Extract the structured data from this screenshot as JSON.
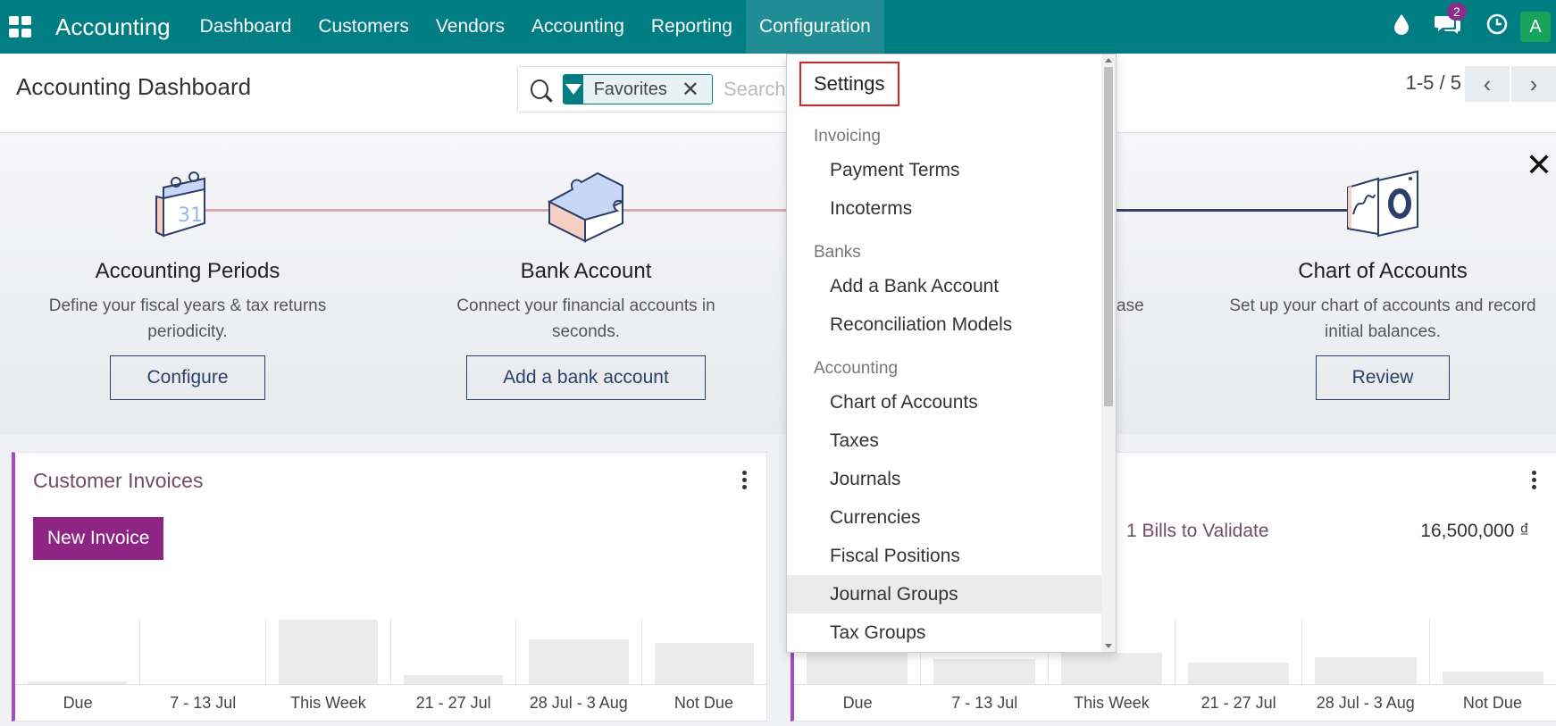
{
  "topbar": {
    "brand": "Accounting",
    "menu": [
      "Dashboard",
      "Customers",
      "Vendors",
      "Accounting",
      "Reporting",
      "Configuration"
    ],
    "active_menu": "Configuration",
    "messages_badge": "2",
    "avatar_letter": "A"
  },
  "control": {
    "page_title": "Accounting Dashboard",
    "facet_label": "Favorites",
    "search_placeholder": "Search...",
    "pager": "1-5 / 5"
  },
  "onboarding": {
    "steps": [
      {
        "title": "Accounting Periods",
        "desc": "Define your fiscal years & tax returns periodicity.",
        "button": "Configure",
        "icon": "calendar-icon"
      },
      {
        "title": "Bank Account",
        "desc": "Connect your financial accounts in seconds.",
        "button": "Add a bank account",
        "icon": "puzzle-icon"
      },
      {
        "title": "Chart of Accounts",
        "desc": "Set up your chart of accounts and record initial balances.",
        "button": "Review",
        "icon": "chart-board-icon"
      }
    ],
    "partial_text": "ase",
    "colors": {
      "line_left": "#d9a7b0",
      "line_right": "#3d3d6b"
    }
  },
  "cards": {
    "customer": {
      "title": "Customer Invoices",
      "new_button": "New Invoice",
      "chart": {
        "labels": [
          "Due",
          "7 - 13 Jul",
          "This Week",
          "21 - 27 Jul",
          "28 Jul - 3 Aug",
          "Not Due"
        ],
        "values": [
          3,
          0,
          72,
          10,
          50,
          46
        ]
      }
    },
    "vendor": {
      "bills_link": "1 Bills to Validate",
      "bills_amount": "16,500,000 ₫",
      "chart": {
        "labels": [
          "Due",
          "7 - 13 Jul",
          "This Week",
          "21 - 27 Jul",
          "28 Jul - 3 Aug",
          "Not Due"
        ],
        "values": [
          35,
          28,
          35,
          24,
          30,
          14
        ]
      }
    }
  },
  "dropdown": {
    "settings": "Settings",
    "sections": [
      {
        "header": "Invoicing",
        "items": [
          "Payment Terms",
          "Incoterms"
        ]
      },
      {
        "header": "Banks",
        "items": [
          "Add a Bank Account",
          "Reconciliation Models"
        ]
      },
      {
        "header": "Accounting",
        "items": [
          "Chart of Accounts",
          "Taxes",
          "Journals",
          "Currencies",
          "Fiscal Positions",
          "Journal Groups",
          "Tax Groups"
        ]
      }
    ],
    "hovered": "Journal Groups"
  },
  "colors": {
    "brand": "#017e84",
    "accent": "#714b67",
    "button": "#8e2585",
    "highlight": "#e02020"
  }
}
